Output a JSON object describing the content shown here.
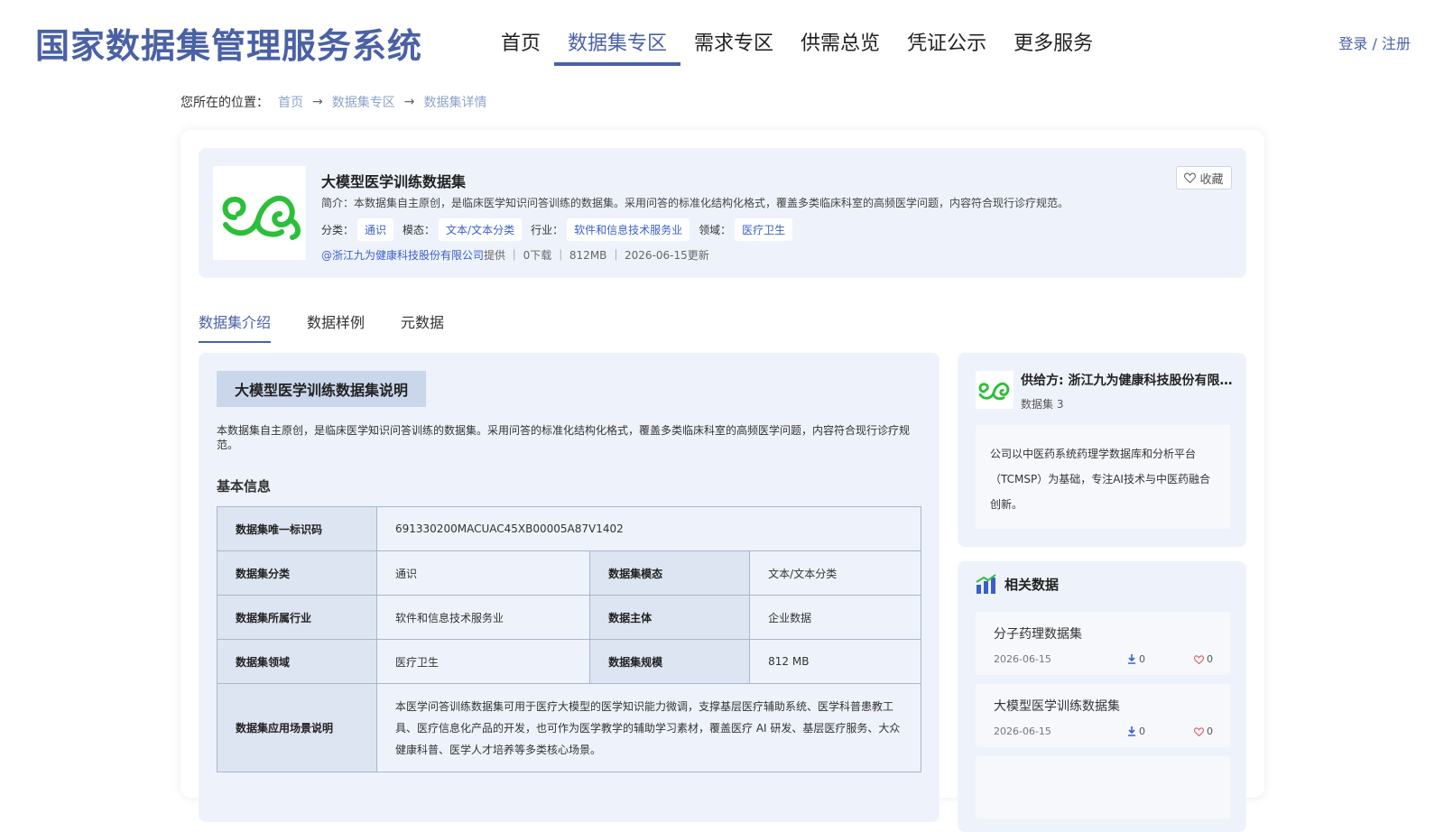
{
  "header": {
    "brand": "国家数据集管理服务系统",
    "nav": [
      "首页",
      "数据集专区",
      "需求专区",
      "供需总览",
      "凭证公示",
      "更多服务"
    ],
    "login": "登录 / 注册"
  },
  "breadcrumb": {
    "label": "您所在的位置：",
    "items": [
      "首页",
      "数据集专区",
      "数据集详情"
    ]
  },
  "dataset": {
    "title": "大模型医学训练数据集",
    "intro": "简介：本数据集自主原创，是临床医学知识问答训练的数据集。采用问答的标准化结构化格式，覆盖多类临床科室的高频医学问题，内容符合现行诊疗规范。",
    "tags": [
      {
        "key": "分类：",
        "value": "通识"
      },
      {
        "key": "模态：",
        "value": "文本/文本分类"
      },
      {
        "key": "行业：",
        "value": "软件和信息技术服务业"
      },
      {
        "key": "领域：",
        "value": "医疗卫生"
      }
    ],
    "org": "@浙江九为健康科技股份有限公司",
    "meta_rest": "提供 ｜ 0下载 ｜ 812MB ｜ 2026-06-15更新",
    "fav_label": "收藏"
  },
  "tabs": [
    "数据集介绍",
    "数据样例",
    "元数据"
  ],
  "intro_section": {
    "title": "大模型医学训练数据集说明",
    "desc": "本数据集自主原创，是临床医学知识问答训练的数据集。采用问答的标准化结构化格式，覆盖多类临床科室的高频医学问题，内容符合现行诊疗规范。",
    "basic_title": "基本信息",
    "rows": {
      "uid_label": "数据集唯一标识码",
      "uid_value": "691330200MACUAC45XB00005A87V1402",
      "cat_label": "数据集分类",
      "cat_value": "通识",
      "modal_label": "数据集模态",
      "modal_value": "文本/文本分类",
      "industry_label": "数据集所属行业",
      "industry_value": "软件和信息技术服务业",
      "subject_label": "数据主体",
      "subject_value": "企业数据",
      "domain_label": "数据集领域",
      "domain_value": "医疗卫生",
      "scale_label": "数据集规模",
      "scale_value": "812 MB",
      "scene_label": "数据集应用场景说明",
      "scene_value": "本医学问答训练数据集可用于医疗大模型的医学知识能力微调，支撑基层医疗辅助系统、医学科普患教工具、医疗信息化产品的开发，也可作为医学教学的辅助学习素材，覆盖医疗 AI 研发、基层医疗服务、大众健康科普、医学人才培养等多类核心场景。"
    }
  },
  "supplier": {
    "name": "供给方: 浙江九为健康科技股份有限公司",
    "count": "数据集 3",
    "desc": "公司以中医药系统药理学数据库和分析平台（TCMSP）为基础，专注AI技术与中医药融合创新。"
  },
  "related": {
    "title": "相关数据",
    "items": [
      {
        "name": "分子药理数据集",
        "date": "2026-06-15",
        "downloads": "0",
        "likes": "0"
      },
      {
        "name": "大模型医学训练数据集",
        "date": "2026-06-15",
        "downloads": "0",
        "likes": "0"
      }
    ]
  },
  "colors": {
    "accent": "#4a61a5",
    "tag_text": "#3a5fc8",
    "panel_bg": "#eef3fb",
    "logo_green": "#2bbf3a"
  },
  "icons": [
    "arrow-right-icon",
    "heart-icon",
    "download-icon",
    "chart-icon",
    "logo-swirl"
  ]
}
